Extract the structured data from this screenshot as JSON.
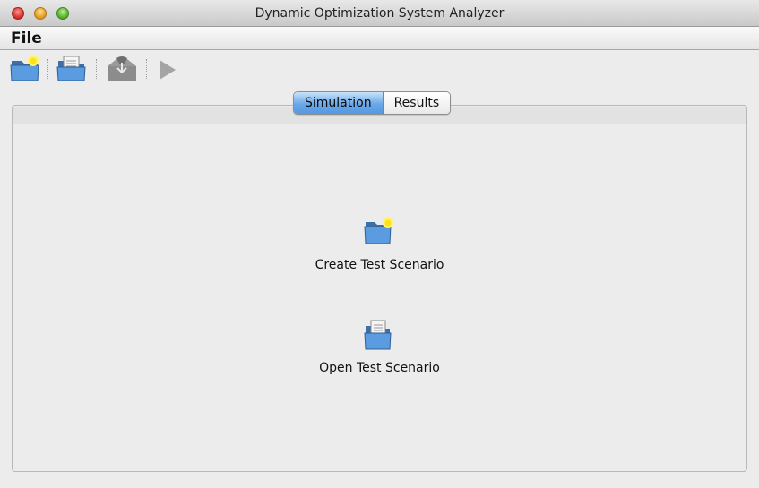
{
  "window": {
    "title": "Dynamic Optimization System Analyzer"
  },
  "menu": {
    "file": "File"
  },
  "toolbar": {
    "buttons": [
      {
        "icon": "new-folder-icon"
      },
      {
        "icon": "open-folder-icon"
      },
      {
        "icon": "save-icon"
      },
      {
        "icon": "play-icon"
      }
    ]
  },
  "tabs": [
    {
      "label": "Simulation",
      "active": true
    },
    {
      "label": "Results",
      "active": false
    }
  ],
  "main": {
    "create_label": "Create Test Scenario",
    "open_label": "Open Test Scenario"
  },
  "colors": {
    "folder_blue": "#4d8fd6",
    "tab_active": "#5499e3"
  }
}
